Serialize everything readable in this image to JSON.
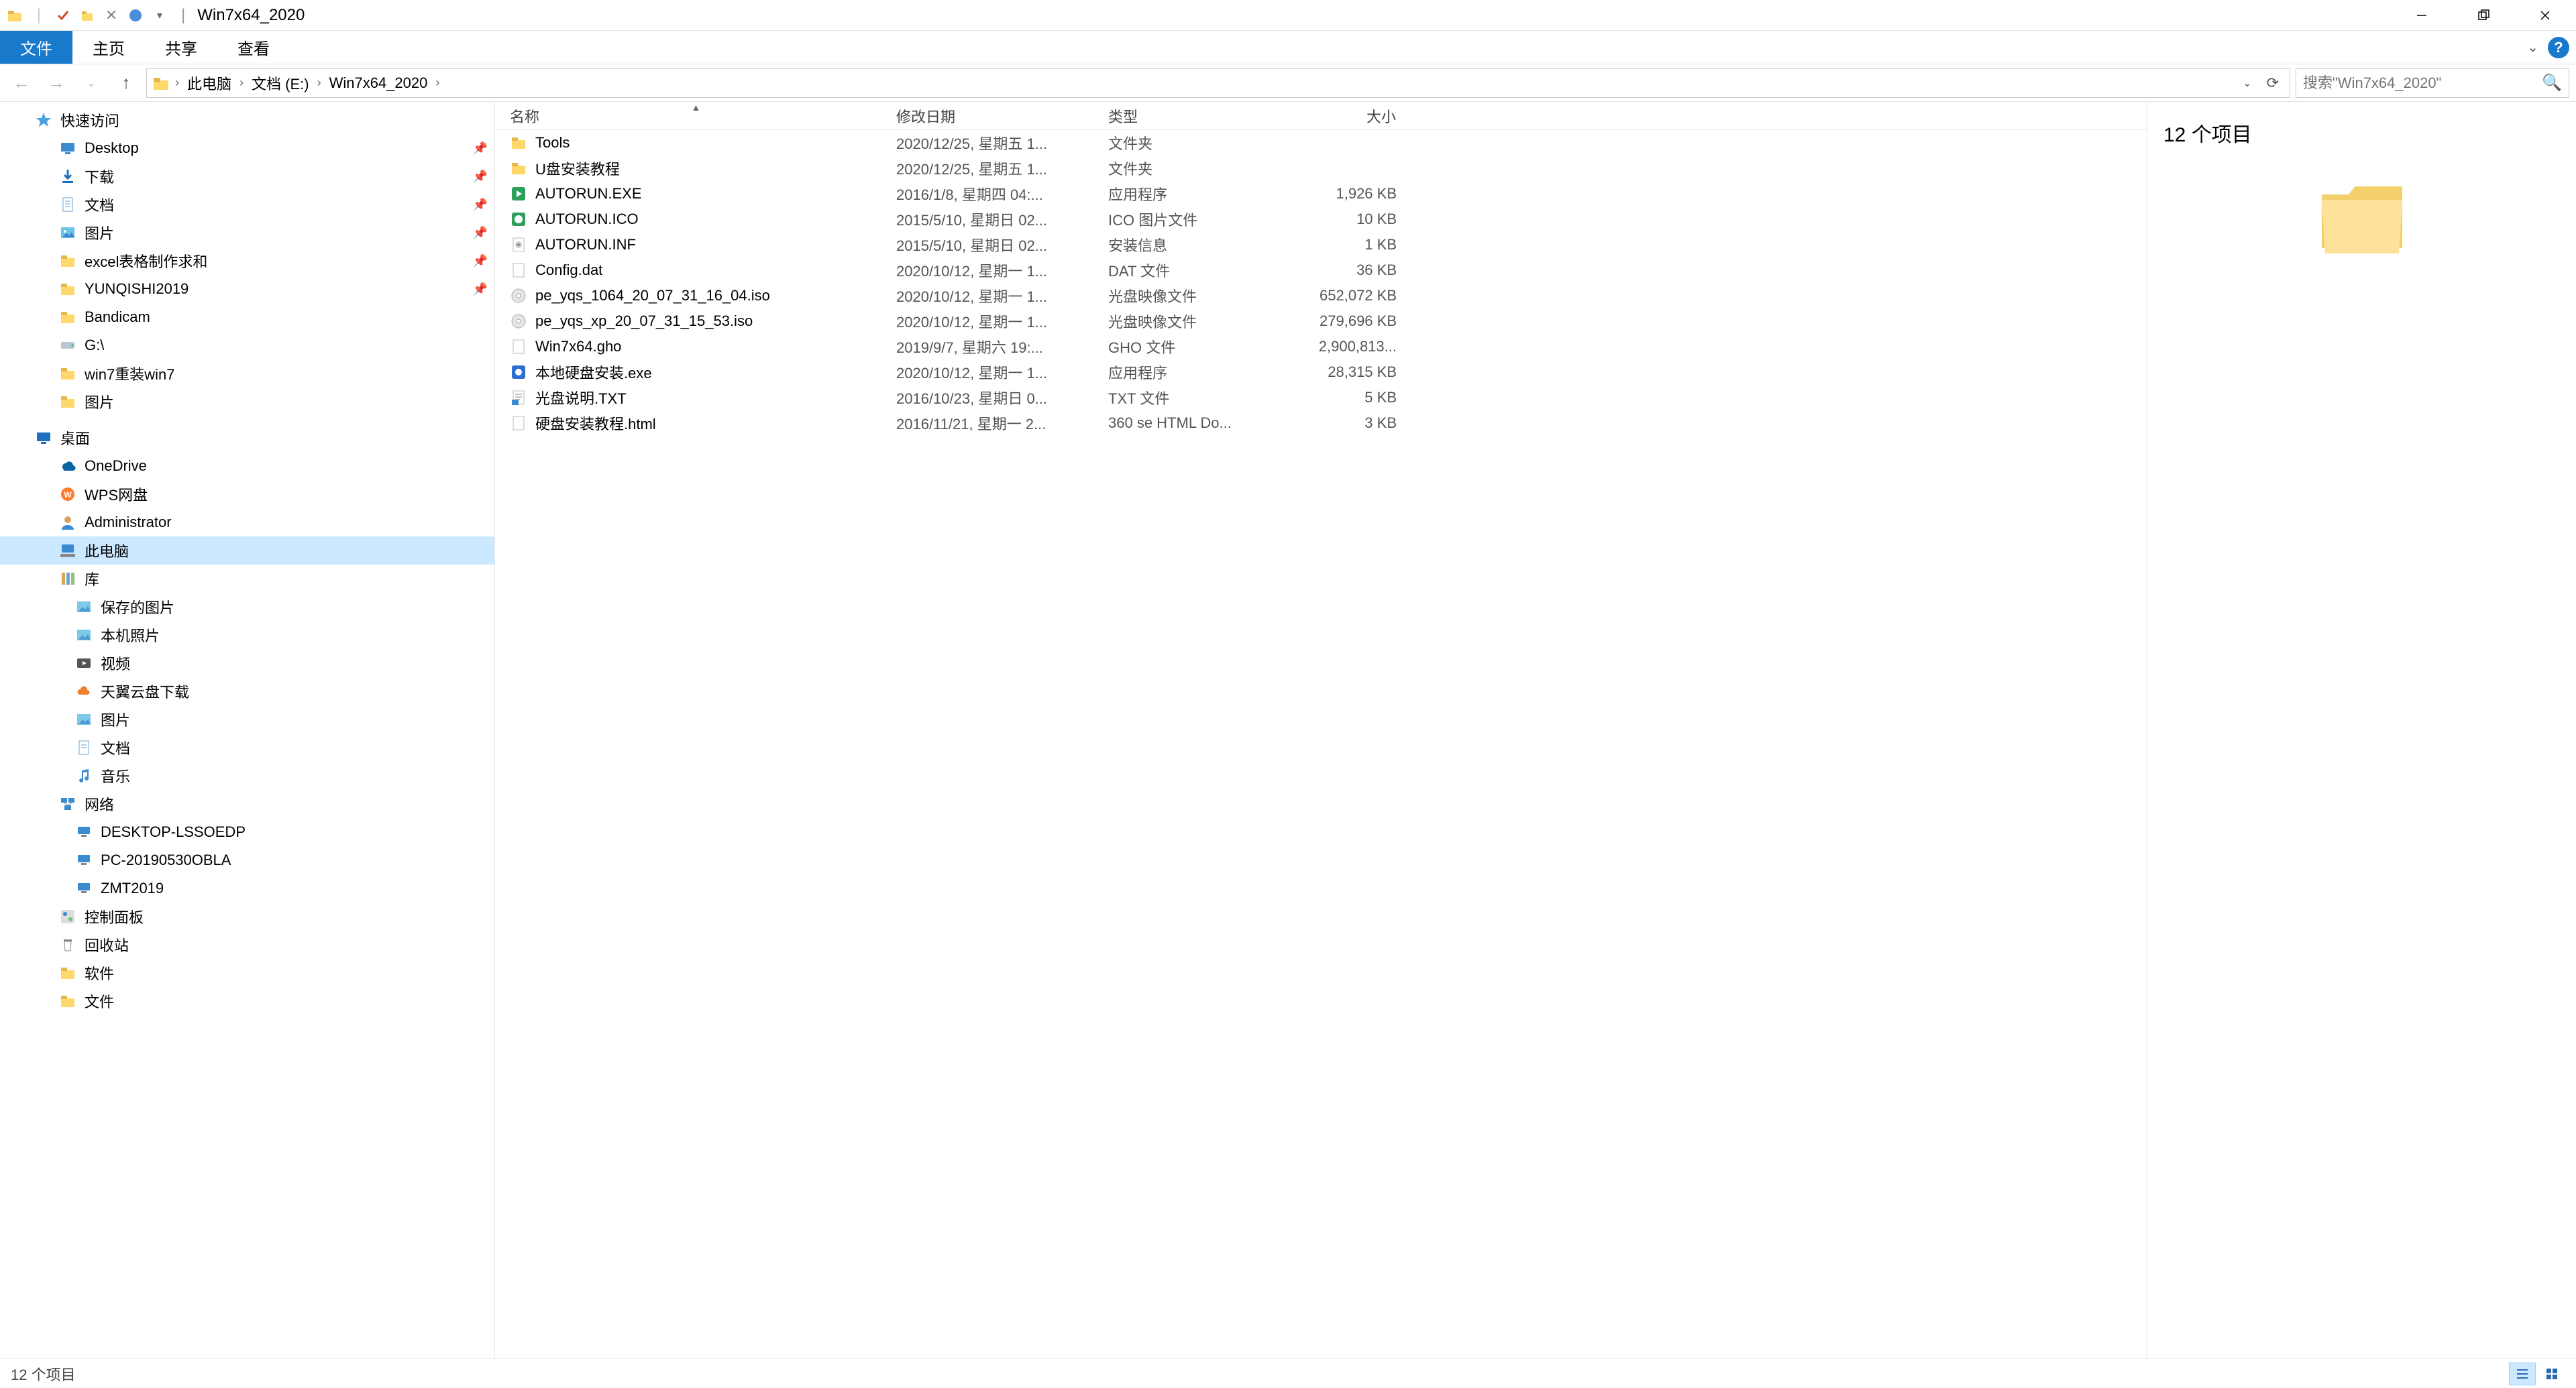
{
  "window": {
    "title": "Win7x64_2020"
  },
  "ribbon": {
    "file": "文件",
    "tabs": [
      "主页",
      "共享",
      "查看"
    ]
  },
  "breadcrumbs": [
    "此电脑",
    "文档 (E:)",
    "Win7x64_2020"
  ],
  "search": {
    "placeholder": "搜索\"Win7x64_2020\""
  },
  "sidebar": {
    "groups": [
      {
        "items": [
          {
            "label": "快速访问",
            "icon": "star",
            "indent": 40,
            "bold": false
          },
          {
            "label": "Desktop",
            "icon": "desktop",
            "indent": 76,
            "pin": true
          },
          {
            "label": "下载",
            "icon": "download",
            "indent": 76,
            "pin": true
          },
          {
            "label": "文档",
            "icon": "doc",
            "indent": 76,
            "pin": true
          },
          {
            "label": "图片",
            "icon": "pic",
            "indent": 76,
            "pin": true
          },
          {
            "label": "excel表格制作求和",
            "icon": "folder",
            "indent": 76,
            "pin": true
          },
          {
            "label": "YUNQISHI2019",
            "icon": "folder",
            "indent": 76,
            "pin": true
          },
          {
            "label": "Bandicam",
            "icon": "folder",
            "indent": 76
          },
          {
            "label": "G:\\",
            "icon": "drive",
            "indent": 76
          },
          {
            "label": "win7重装win7",
            "icon": "folder",
            "indent": 76
          },
          {
            "label": "图片",
            "icon": "folder",
            "indent": 76
          }
        ]
      },
      {
        "items": [
          {
            "label": "桌面",
            "icon": "desktop-blue",
            "indent": 40
          },
          {
            "label": "OneDrive",
            "icon": "onedrive",
            "indent": 76
          },
          {
            "label": "WPS网盘",
            "icon": "wps",
            "indent": 76
          },
          {
            "label": "Administrator",
            "icon": "user",
            "indent": 76
          },
          {
            "label": "此电脑",
            "icon": "pc",
            "indent": 76,
            "selected": true
          },
          {
            "label": "库",
            "icon": "library",
            "indent": 76
          },
          {
            "label": "保存的图片",
            "icon": "pic-lib",
            "indent": 100
          },
          {
            "label": "本机照片",
            "icon": "pic-lib",
            "indent": 100
          },
          {
            "label": "视频",
            "icon": "video-lib",
            "indent": 100
          },
          {
            "label": "天翼云盘下载",
            "icon": "cloud",
            "indent": 100
          },
          {
            "label": "图片",
            "icon": "pic-lib",
            "indent": 100
          },
          {
            "label": "文档",
            "icon": "doc-lib",
            "indent": 100
          },
          {
            "label": "音乐",
            "icon": "music-lib",
            "indent": 100
          },
          {
            "label": "网络",
            "icon": "network",
            "indent": 76
          },
          {
            "label": "DESKTOP-LSSOEDP",
            "icon": "pc-net",
            "indent": 100
          },
          {
            "label": "PC-20190530OBLA",
            "icon": "pc-net",
            "indent": 100
          },
          {
            "label": "ZMT2019",
            "icon": "pc-net",
            "indent": 100
          },
          {
            "label": "控制面板",
            "icon": "control",
            "indent": 76
          },
          {
            "label": "回收站",
            "icon": "recycle",
            "indent": 76
          },
          {
            "label": "软件",
            "icon": "folder",
            "indent": 76
          },
          {
            "label": "文件",
            "icon": "folder",
            "indent": 76
          }
        ]
      }
    ]
  },
  "columns": {
    "name": "名称",
    "date": "修改日期",
    "type": "类型",
    "size": "大小"
  },
  "files": [
    {
      "name": "Tools",
      "date": "2020/12/25, 星期五 1...",
      "type": "文件夹",
      "size": "",
      "icon": "folder"
    },
    {
      "name": "U盘安装教程",
      "date": "2020/12/25, 星期五 1...",
      "type": "文件夹",
      "size": "",
      "icon": "folder"
    },
    {
      "name": "AUTORUN.EXE",
      "date": "2016/1/8, 星期四 04:...",
      "type": "应用程序",
      "size": "1,926 KB",
      "icon": "exe-green"
    },
    {
      "name": "AUTORUN.ICO",
      "date": "2015/5/10, 星期日 02...",
      "type": "ICO 图片文件",
      "size": "10 KB",
      "icon": "ico"
    },
    {
      "name": "AUTORUN.INF",
      "date": "2015/5/10, 星期日 02...",
      "type": "安装信息",
      "size": "1 KB",
      "icon": "inf"
    },
    {
      "name": "Config.dat",
      "date": "2020/10/12, 星期一 1...",
      "type": "DAT 文件",
      "size": "36 KB",
      "icon": "dat"
    },
    {
      "name": "pe_yqs_1064_20_07_31_16_04.iso",
      "date": "2020/10/12, 星期一 1...",
      "type": "光盘映像文件",
      "size": "652,072 KB",
      "icon": "iso"
    },
    {
      "name": "pe_yqs_xp_20_07_31_15_53.iso",
      "date": "2020/10/12, 星期一 1...",
      "type": "光盘映像文件",
      "size": "279,696 KB",
      "icon": "iso"
    },
    {
      "name": "Win7x64.gho",
      "date": "2019/9/7, 星期六 19:...",
      "type": "GHO 文件",
      "size": "2,900,813...",
      "icon": "gho"
    },
    {
      "name": "本地硬盘安装.exe",
      "date": "2020/10/12, 星期一 1...",
      "type": "应用程序",
      "size": "28,315 KB",
      "icon": "exe-blue"
    },
    {
      "name": "光盘说明.TXT",
      "date": "2016/10/23, 星期日 0...",
      "type": "TXT 文件",
      "size": "5 KB",
      "icon": "txt"
    },
    {
      "name": "硬盘安装教程.html",
      "date": "2016/11/21, 星期一 2...",
      "type": "360 se HTML Do...",
      "size": "3 KB",
      "icon": "html"
    }
  ],
  "preview": {
    "title": "12 个项目"
  },
  "status": {
    "text": "12 个项目"
  }
}
